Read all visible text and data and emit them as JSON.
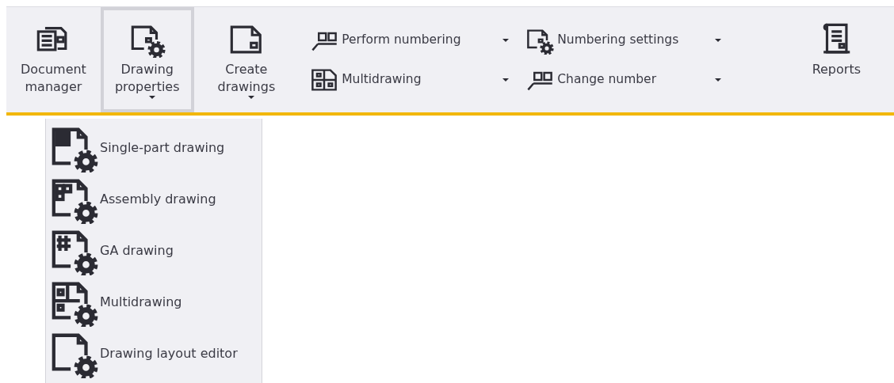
{
  "ribbon": {
    "items": [
      {
        "kind": "large",
        "label": "Document manager",
        "selected": false,
        "dropdown": false
      },
      {
        "kind": "large",
        "label": "Drawing properties",
        "selected": true,
        "dropdown": true
      },
      {
        "kind": "large",
        "label": "Create drawings",
        "selected": false,
        "dropdown": true
      },
      {
        "kind": "stack",
        "buttons": [
          {
            "label": "Perform numbering",
            "dropdown": true
          },
          {
            "label": "Multidrawing",
            "dropdown": true
          }
        ]
      },
      {
        "kind": "stack",
        "buttons": [
          {
            "label": "Numbering settings",
            "dropdown": true
          },
          {
            "label": "Change number",
            "dropdown": true
          }
        ]
      },
      {
        "kind": "large",
        "label": "Reports",
        "selected": false,
        "dropdown": false
      }
    ]
  },
  "menu": {
    "items": [
      {
        "label": "Single-part drawing"
      },
      {
        "label": "Assembly drawing"
      },
      {
        "label": "GA drawing"
      },
      {
        "label": "Multidrawing"
      },
      {
        "label": "Drawing layout editor"
      }
    ]
  }
}
